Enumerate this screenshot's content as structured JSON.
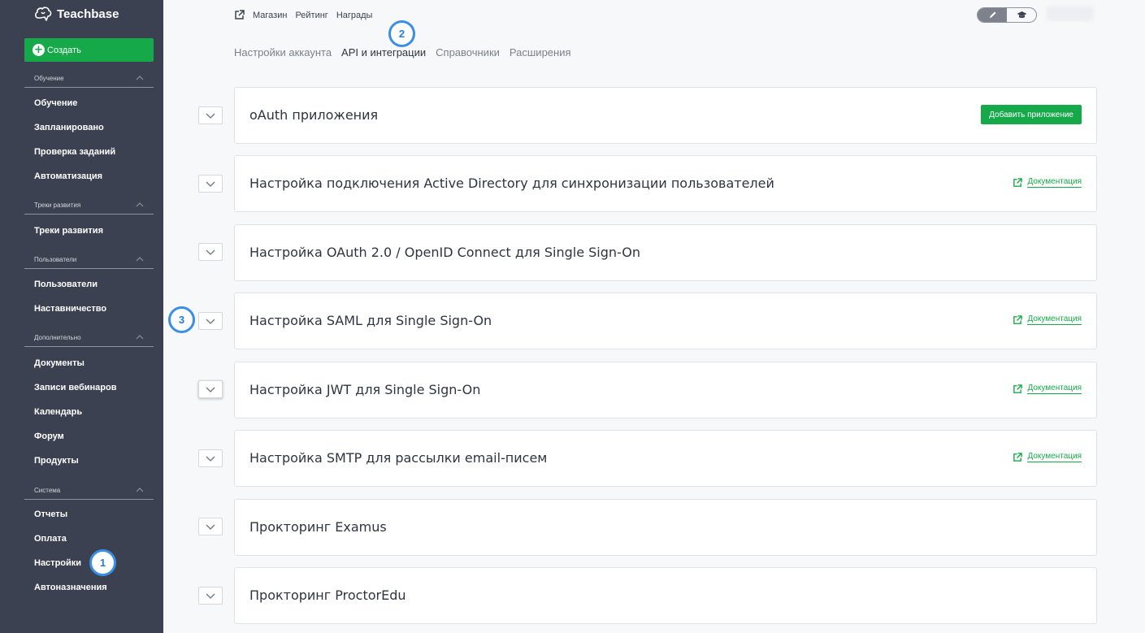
{
  "sidebar": {
    "logo": "Teachbase",
    "create_label": "Создать",
    "sections": [
      {
        "title": "Обучение",
        "items": [
          "Обучение",
          "Запланировано",
          "Проверка заданий",
          "Автоматизация"
        ]
      },
      {
        "title": "Треки развития",
        "items": [
          "Треки развития"
        ]
      },
      {
        "title": "Пользователи",
        "items": [
          "Пользователи",
          "Наставничество"
        ]
      },
      {
        "title": "Дополнительно",
        "items": [
          "Документы",
          "Записи вебинаров",
          "Календарь",
          "Форум",
          "Продукты"
        ]
      },
      {
        "title": "Система",
        "items": [
          "Отчеты",
          "Оплата",
          "Настройки",
          "Автоназначения"
        ]
      }
    ]
  },
  "topbar": {
    "links": [
      "Магазин",
      "Рейтинг",
      "Награды"
    ]
  },
  "tabs": [
    "Настройки аккаунта",
    "API и интеграции",
    "Справочники",
    "Расширения"
  ],
  "active_tab": "API и интеграции",
  "markers": [
    "1",
    "2",
    "3"
  ],
  "cards": [
    {
      "title": "oAuth приложения",
      "button": "Добавить приложение"
    },
    {
      "title": "Настройка подключения Active Directory для синхронизации пользователей",
      "doc": "Документация"
    },
    {
      "title": "Настройка OAuth 2.0 / OpenID Connect для Single Sign-On"
    },
    {
      "title": "Настройка SAML для Single Sign-On",
      "doc": "Документация"
    },
    {
      "title": "Настройка JWT для Single Sign-On",
      "doc": "Документация"
    },
    {
      "title": "Настройка SMTP для рассылки email-писем",
      "doc": "Документация"
    },
    {
      "title": "Прокторинг Examus"
    },
    {
      "title": "Прокторинг ProctorEdu"
    }
  ],
  "colors": {
    "sidebar": "#3b4150",
    "accent_green": "#16a94a",
    "marker_blue": "#3a8ee6",
    "background": "#f7f8fa"
  }
}
